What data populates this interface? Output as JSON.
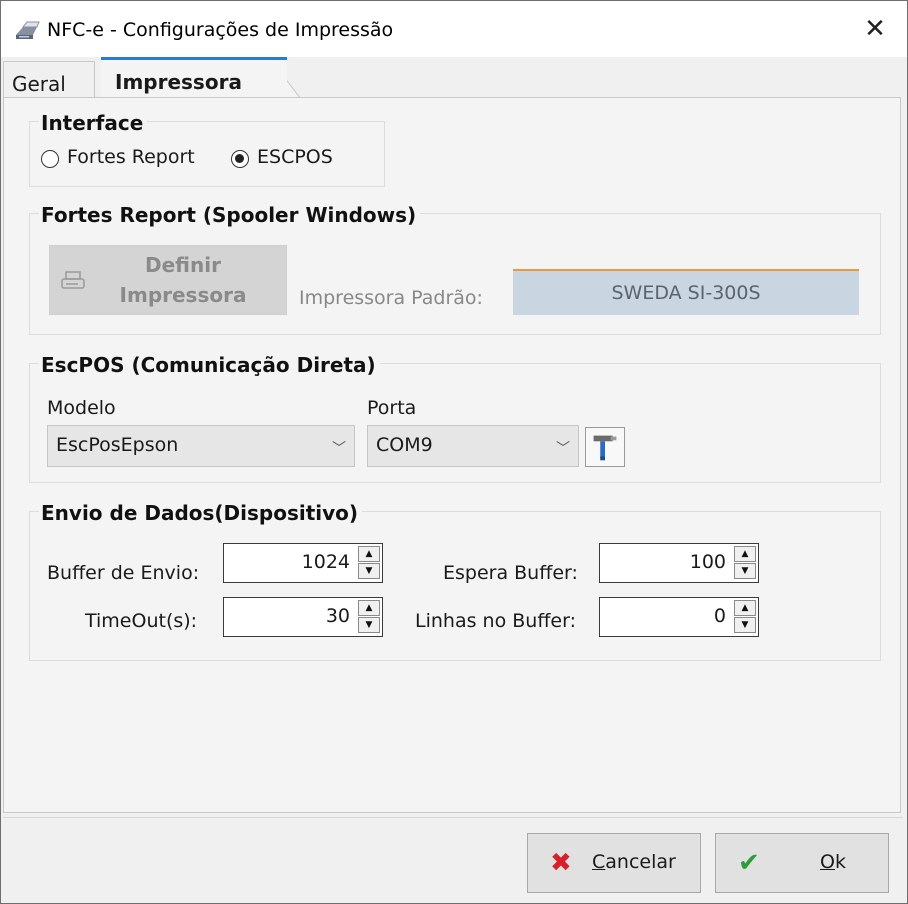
{
  "window": {
    "title": "NFC-e - Configurações de Impressão",
    "close_symbol": "✕",
    "icon": "printer-icon"
  },
  "tabs": [
    {
      "label": "Geral",
      "active": false
    },
    {
      "label": "Impressora",
      "active": true
    }
  ],
  "interface_group": {
    "title": "Interface",
    "options": [
      {
        "label": "Fortes Report",
        "selected": false
      },
      {
        "label": "ESCPOS",
        "selected": true
      }
    ]
  },
  "fortes_group": {
    "title": "Fortes Report (Spooler Windows)",
    "define_button": {
      "line1": "Definir",
      "line2": "Impressora",
      "enabled": false
    },
    "default_printer_label": "Impressora Padrão:",
    "default_printer_value": "SWEDA SI-300S"
  },
  "escpos_group": {
    "title": "EscPOS (Comunicação Direta)",
    "modelo_label": "Modelo",
    "modelo_value": "EscPosEpson",
    "porta_label": "Porta",
    "porta_value": "COM9",
    "tool_icon": "hammer-icon"
  },
  "envio_group": {
    "title": "Envio de Dados(Dispositivo)",
    "buffer_envio_label": "Buffer de Envio:",
    "buffer_envio_value": "1024",
    "espera_buffer_label": "Espera Buffer:",
    "espera_buffer_value": "100",
    "timeout_label": "TimeOut(s):",
    "timeout_value": "30",
    "linhas_buffer_label": "Linhas no Buffer:",
    "linhas_buffer_value": "0"
  },
  "footer": {
    "cancel": {
      "prefix": "C",
      "rest": "ancelar",
      "icon": "x-icon",
      "icon_color": "#d8202a"
    },
    "ok": {
      "prefix": "O",
      "rest": "k",
      "icon": "check-icon",
      "icon_color": "#2f9a3a"
    }
  }
}
